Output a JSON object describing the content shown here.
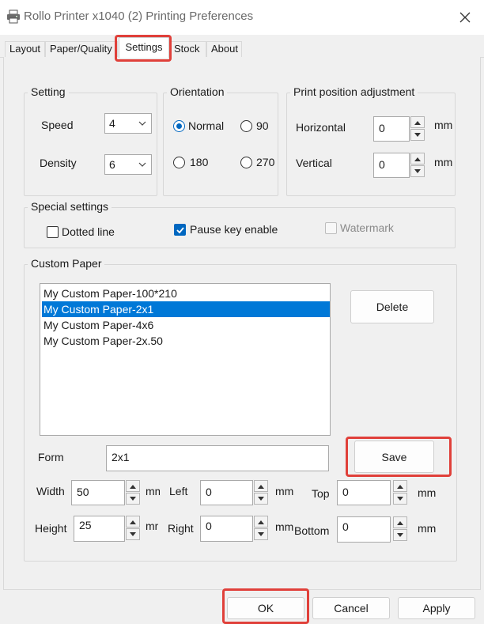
{
  "window": {
    "title": "Rollo Printer x1040 (2) Printing Preferences",
    "icons": {
      "app": "printer-icon",
      "close": "close-icon"
    }
  },
  "tabs": [
    "Layout",
    "Paper/Quality",
    "Settings",
    "Stock",
    "About"
  ],
  "active_tab": "Settings",
  "setting": {
    "title": "Setting",
    "speed_label": "Speed",
    "speed_value": "4",
    "density_label": "Density",
    "density_value": "6"
  },
  "orientation": {
    "title": "Orientation",
    "options": [
      "Normal",
      "90",
      "180",
      "270"
    ],
    "selected": "Normal"
  },
  "position": {
    "title": "Print position adjustment",
    "horizontal_label": "Horizontal",
    "horizontal_value": "0",
    "vertical_label": "Vertical",
    "vertical_value": "0",
    "unit": "mm"
  },
  "special": {
    "title": "Special settings",
    "dotted_line": {
      "label": "Dotted line",
      "checked": false
    },
    "pause_key": {
      "label": "Pause key enable",
      "checked": true
    },
    "watermark": {
      "label": "Watermark",
      "checked": false,
      "enabled": false
    }
  },
  "custom_paper": {
    "title": "Custom Paper",
    "items": [
      "My Custom Paper-100*210",
      "My Custom Paper-2x1",
      "My Custom Paper-4x6",
      "My Custom Paper-2x.50"
    ],
    "selected_index": 1,
    "delete_label": "Delete",
    "form_label": "Form",
    "form_value": "2x1",
    "save_label": "Save",
    "width_label": "Width",
    "width_value": "50",
    "height_label": "Height",
    "height_value": "25",
    "left_label": "Left",
    "left_value": "0",
    "right_label": "Right",
    "right_value": "0",
    "top_label": "Top",
    "top_value": "0",
    "bottom_label": "Bottom",
    "bottom_value": "0",
    "unit": "mm"
  },
  "footer": {
    "ok_label": "OK",
    "cancel_label": "Cancel",
    "apply_label": "Apply"
  },
  "colors": {
    "accent": "#0067c0",
    "selection": "#0078d7",
    "highlight": "#e0403a"
  }
}
